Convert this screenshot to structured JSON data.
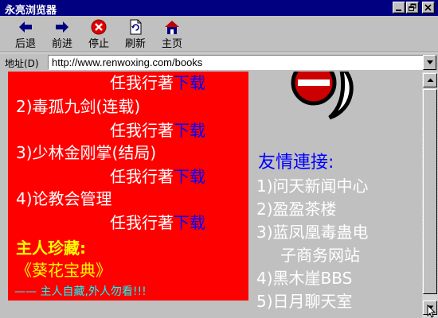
{
  "window": {
    "title": "永亮浏览器"
  },
  "toolbar": {
    "back_label": "后退",
    "forward_label": "前进",
    "stop_label": "停止",
    "refresh_label": "刷新",
    "home_label": "主页"
  },
  "address": {
    "label": "地址(D)",
    "url": "http://www.renwoxing.com/books"
  },
  "content": {
    "books": [
      {
        "title": "",
        "author": "任我行著",
        "download": "下载"
      },
      {
        "title": "2)毒孤九剑(连载)",
        "author": "任我行著",
        "download": "下载"
      },
      {
        "title": "3)少林金刚掌(结局)",
        "author": "任我行著",
        "download": "下载"
      },
      {
        "title": "4)论教会管理",
        "author": "任我行著",
        "download": "下载"
      }
    ],
    "treasure_title": "主人珍藏:",
    "treasure_book": "《葵花宝典》",
    "treasure_note": "—— 主人自藏,外人勿看!!!",
    "friends_title": "友情連接:",
    "friend_links": [
      "1)问天新闻中心",
      "2)盈盈茶楼",
      "3)蓝凤凰毒蛊电",
      "子商务网站",
      "4)黑木崖BBS",
      "5)日月聊天室"
    ]
  },
  "colors": {
    "title_bar": "#000080",
    "content_bg": "#ff0000",
    "download_link": "#0000ff",
    "treasure_title": "#ffff00",
    "treasure_note": "#00ffff",
    "friends_title": "#0000ff"
  },
  "icons": {
    "back": "left-arrow-icon",
    "forward": "right-arrow-icon",
    "stop": "stop-icon",
    "refresh": "refresh-icon",
    "home": "home-icon"
  }
}
